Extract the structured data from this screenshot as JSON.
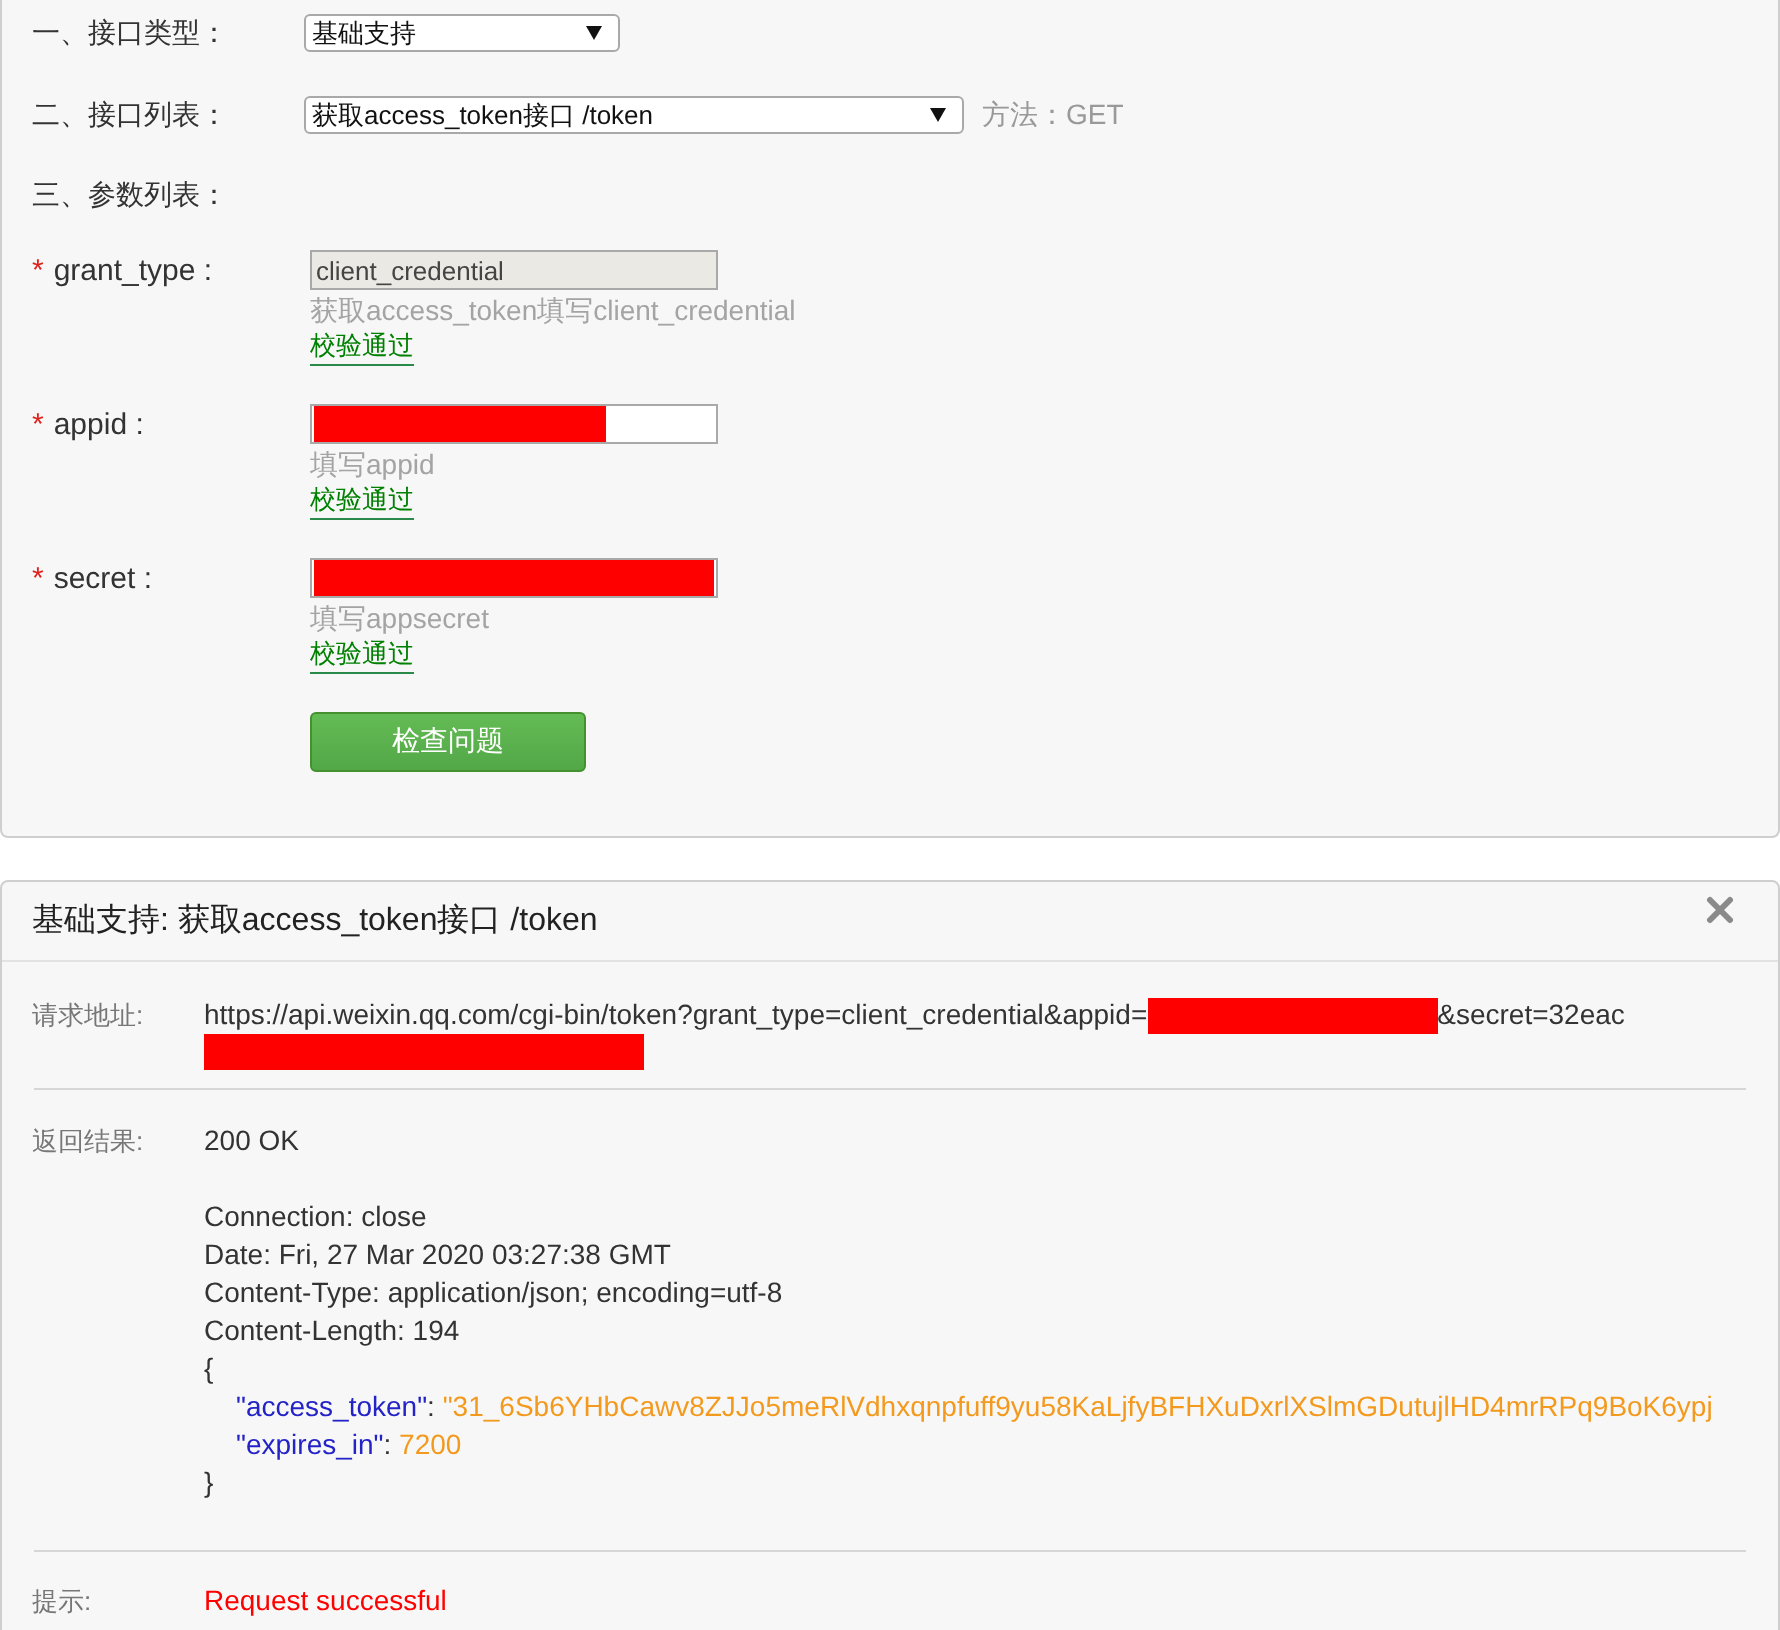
{
  "form": {
    "interface_type": {
      "label": "一、接口类型：",
      "value": "基础支持"
    },
    "interface_list": {
      "label": "二、接口列表：",
      "value": "获取access_token接口 /token",
      "method": "方法：GET"
    },
    "params_heading": "三、参数列表：",
    "params": [
      {
        "mark": "*",
        "name": "grant_type :",
        "value": "client_credential",
        "disabled": true,
        "masked": false,
        "hint": "获取access_token填写client_credential",
        "status": "校验通过"
      },
      {
        "mark": "*",
        "name": "appid :",
        "disabled": false,
        "masked": true,
        "hint": "填写appid",
        "status": "校验通过"
      },
      {
        "mark": "*",
        "name": "secret :",
        "disabled": false,
        "masked": true,
        "hint": "填写appsecret",
        "status": "校验通过"
      }
    ],
    "check_button": "检查问题"
  },
  "result": {
    "title": "基础支持: 获取access_token接口 /token",
    "request": {
      "label": "请求地址:",
      "segments": [
        {
          "kind": "text",
          "text": "https://api.weixin.qq.com/cgi-bin/token?grant_type=client_credential&appid="
        },
        {
          "kind": "redacted"
        },
        {
          "kind": "text",
          "text": "&secret=32eac"
        },
        {
          "kind": "redacted"
        }
      ]
    },
    "response": {
      "label": "返回结果:",
      "status": "200 OK",
      "headers": [
        "Connection: close",
        "Date: Fri, 27 Mar 2020 03:27:38 GMT",
        "Content-Type: application/json; encoding=utf-8",
        "Content-Length: 194"
      ],
      "body_open": "{",
      "body": [
        {
          "key": "\"access_token\"",
          "sep": ": ",
          "value": "\"31_6Sb6YHbCawv8ZJJo5meRlVdhxqnpfuff9yu58KaLjfyBFHXuDxrlXSlmGDutujlHD4mrRPq9BoK6ypj"
        },
        {
          "key": "\"expires_in\"",
          "sep": ": ",
          "value": "7200"
        }
      ],
      "body_close": "}"
    },
    "tip": {
      "label": "提示:",
      "message": "Request successful"
    }
  }
}
